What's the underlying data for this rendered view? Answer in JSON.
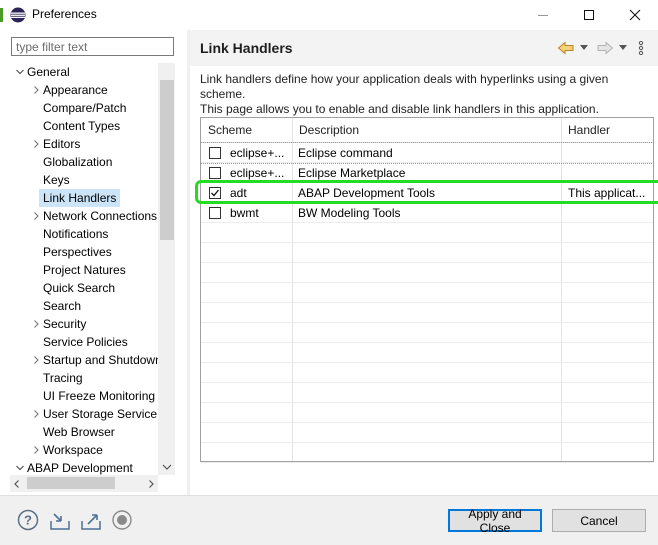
{
  "window": {
    "title": "Preferences"
  },
  "filter": {
    "placeholder": "type filter text"
  },
  "tree": {
    "items": [
      {
        "label": "General",
        "expandable": true,
        "expanded": true,
        "level": 0
      },
      {
        "label": "Appearance",
        "expandable": true,
        "expanded": false,
        "level": 1
      },
      {
        "label": "Compare/Patch",
        "expandable": false,
        "level": 1
      },
      {
        "label": "Content Types",
        "expandable": false,
        "level": 1
      },
      {
        "label": "Editors",
        "expandable": true,
        "expanded": false,
        "level": 1
      },
      {
        "label": "Globalization",
        "expandable": false,
        "level": 1
      },
      {
        "label": "Keys",
        "expandable": false,
        "level": 1
      },
      {
        "label": "Link Handlers",
        "expandable": false,
        "level": 1,
        "selected": true
      },
      {
        "label": "Network Connections",
        "expandable": true,
        "expanded": false,
        "level": 1
      },
      {
        "label": "Notifications",
        "expandable": false,
        "level": 1
      },
      {
        "label": "Perspectives",
        "expandable": false,
        "level": 1
      },
      {
        "label": "Project Natures",
        "expandable": false,
        "level": 1
      },
      {
        "label": "Quick Search",
        "expandable": false,
        "level": 1
      },
      {
        "label": "Search",
        "expandable": false,
        "level": 1
      },
      {
        "label": "Security",
        "expandable": true,
        "expanded": false,
        "level": 1
      },
      {
        "label": "Service Policies",
        "expandable": false,
        "level": 1
      },
      {
        "label": "Startup and Shutdown",
        "expandable": true,
        "expanded": false,
        "level": 1
      },
      {
        "label": "Tracing",
        "expandable": false,
        "level": 1
      },
      {
        "label": "UI Freeze Monitoring",
        "expandable": false,
        "level": 1
      },
      {
        "label": "User Storage Service",
        "expandable": true,
        "expanded": false,
        "level": 1
      },
      {
        "label": "Web Browser",
        "expandable": false,
        "level": 1
      },
      {
        "label": "Workspace",
        "expandable": true,
        "expanded": false,
        "level": 1
      },
      {
        "label": "ABAP Development",
        "expandable": true,
        "expanded": true,
        "level": 0
      }
    ]
  },
  "page": {
    "title": "Link Handlers",
    "description_line1": "Link handlers define how your application deals with hyperlinks using a given scheme.",
    "description_line2": "This page allows you to enable and disable link handlers in this application."
  },
  "table": {
    "columns": [
      "Scheme",
      "Description",
      "Handler"
    ],
    "rows": [
      {
        "checked": false,
        "scheme": "eclipse+...",
        "description": "Eclipse command",
        "handler": ""
      },
      {
        "checked": false,
        "scheme": "eclipse+...",
        "description": "Eclipse Marketplace",
        "handler": ""
      },
      {
        "checked": true,
        "scheme": "adt",
        "description": "ABAP Development Tools",
        "handler": "This applicat..."
      },
      {
        "checked": false,
        "scheme": "bwmt",
        "description": "BW Modeling Tools",
        "handler": ""
      }
    ]
  },
  "buttons": {
    "apply_close": "Apply and Close",
    "cancel": "Cancel"
  },
  "icons": {
    "help": "help-icon",
    "import": "import-icon",
    "export": "export-icon",
    "record": "record-icon",
    "back": "back-arrow-icon",
    "forward": "forward-arrow-icon",
    "menu": "view-menu-icon"
  },
  "colors": {
    "highlight": "#22dd22",
    "selection": "#cce4f7",
    "primary_border": "#0078d7"
  }
}
